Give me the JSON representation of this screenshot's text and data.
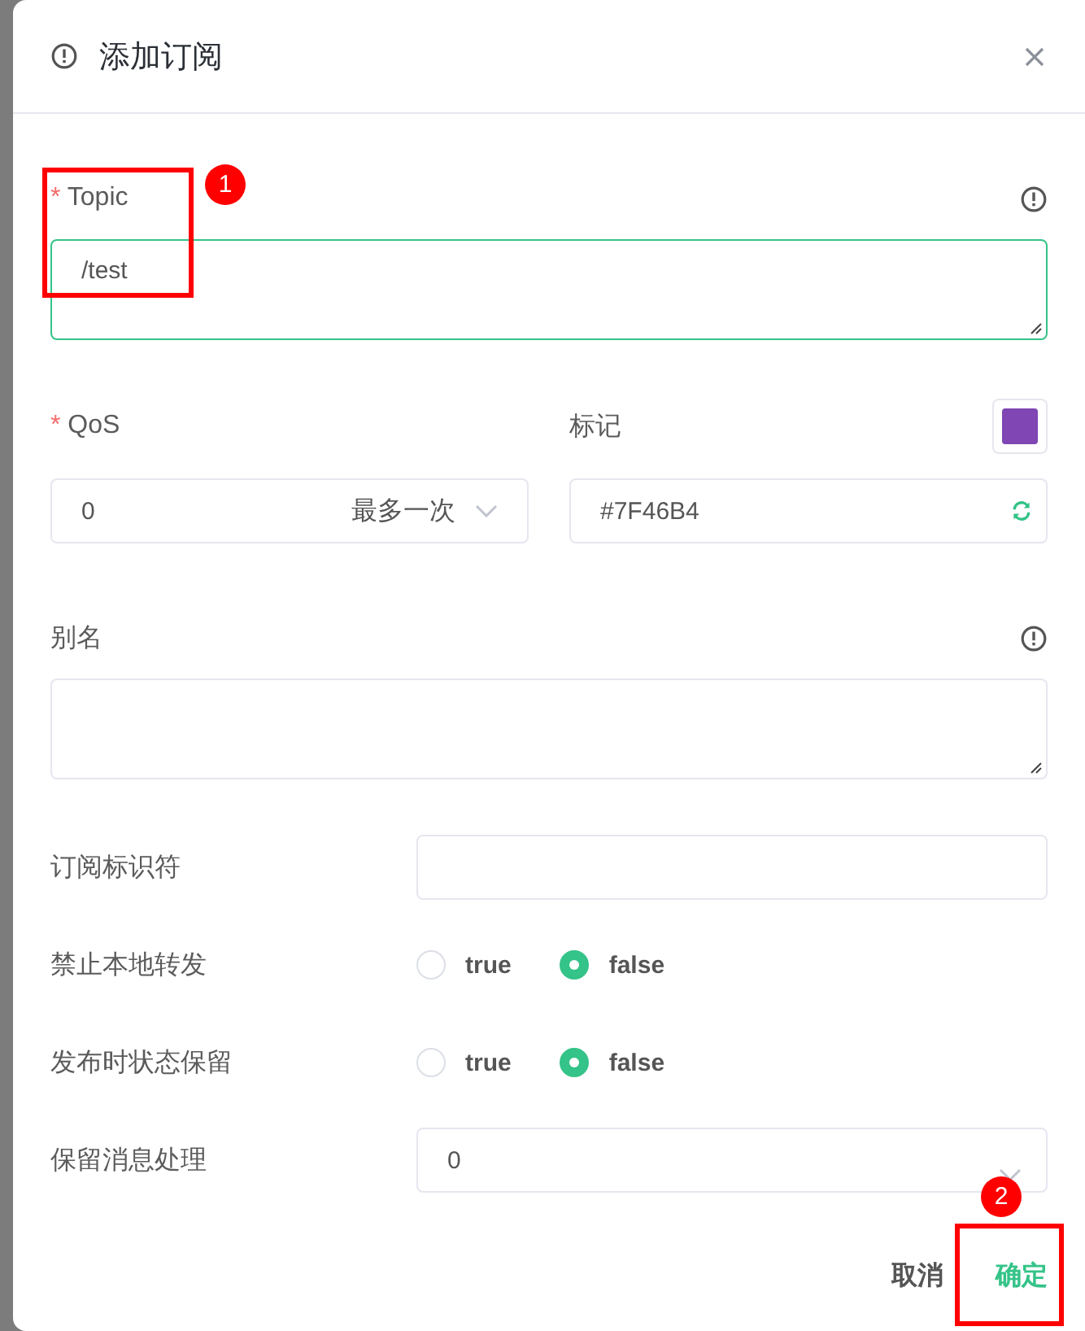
{
  "dialog": {
    "title": "添加订阅"
  },
  "required_mark": "*",
  "topic": {
    "label": "Topic",
    "required": true,
    "value": "/test"
  },
  "qos": {
    "label": "QoS",
    "required": true,
    "value": "0",
    "description": "最多一次"
  },
  "color_tag": {
    "label": "标记",
    "value": "#7F46B4",
    "color": "#7f46b4"
  },
  "alias": {
    "label": "别名"
  },
  "rows": [
    {
      "kind": "input",
      "label": "订阅标识符"
    },
    {
      "kind": "radio",
      "label": "禁止本地转发",
      "options": [
        {
          "label": "true",
          "selected": false
        },
        {
          "label": "false",
          "selected": true
        }
      ]
    },
    {
      "kind": "radio",
      "label": "发布时状态保留",
      "options": [
        {
          "label": "true",
          "selected": false
        },
        {
          "label": "false",
          "selected": true
        }
      ]
    },
    {
      "kind": "select",
      "label": "保留消息处理",
      "value": "0"
    }
  ],
  "buttons": [
    {
      "label": "取消",
      "primary": false
    },
    {
      "label": "确定",
      "primary": true
    }
  ],
  "annotations": [
    {
      "label": "1"
    },
    {
      "label": "2"
    }
  ]
}
